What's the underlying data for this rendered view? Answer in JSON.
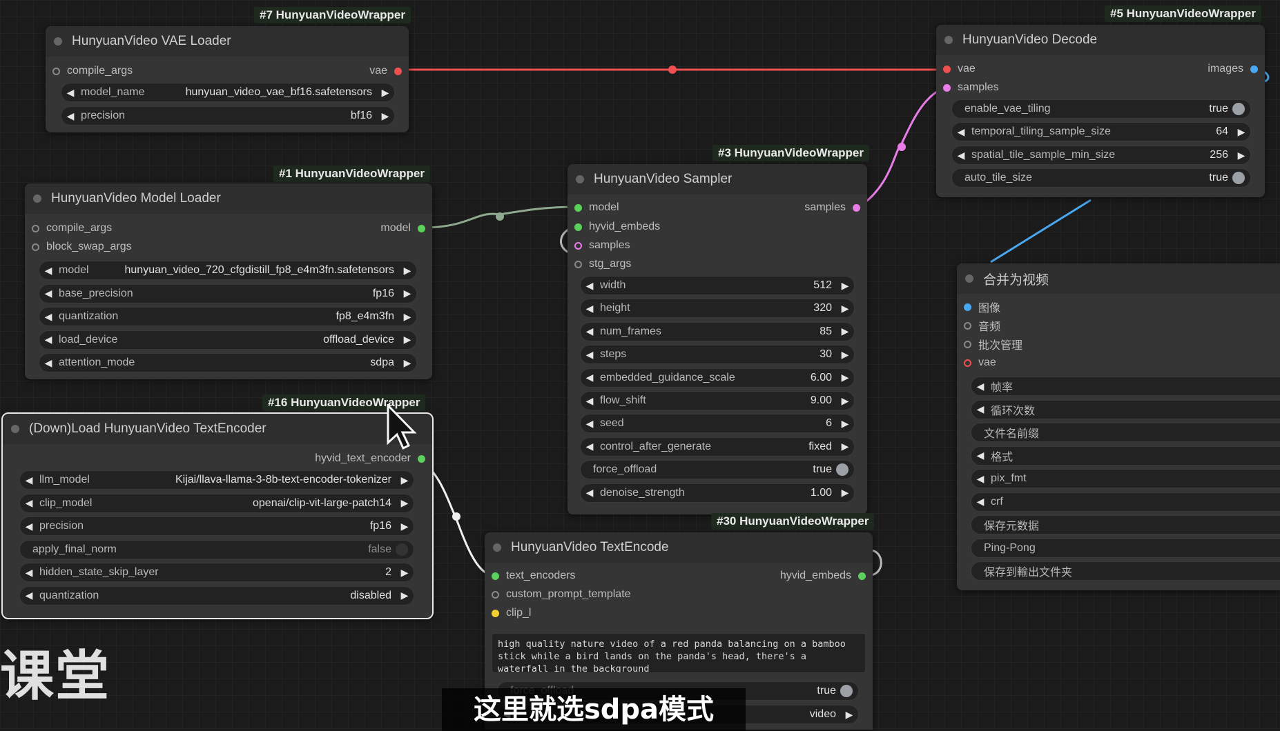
{
  "vae_loader": {
    "badge": "#7 HunyuanVideoWrapper",
    "title": "HunyuanVideo VAE Loader",
    "input_compile_args": "compile_args",
    "output_vae": "vae",
    "model_name_label": "model_name",
    "model_name_value": "hunyuan_video_vae_bf16.safetensors",
    "precision_label": "precision",
    "precision_value": "bf16"
  },
  "model_loader": {
    "badge": "#1 HunyuanVideoWrapper",
    "title": "HunyuanVideo Model Loader",
    "input_compile_args": "compile_args",
    "input_block_swap_args": "block_swap_args",
    "output_model": "model",
    "widgets": [
      {
        "label": "model",
        "value": "hunyuan_video_720_cfgdistill_fp8_e4m3fn.safetensors"
      },
      {
        "label": "base_precision",
        "value": "fp16"
      },
      {
        "label": "quantization",
        "value": "fp8_e4m3fn"
      },
      {
        "label": "load_device",
        "value": "offload_device"
      },
      {
        "label": "attention_mode",
        "value": "sdpa"
      }
    ]
  },
  "text_encoder_loader": {
    "badge": "#16 HunyuanVideoWrapper",
    "title": "(Down)Load HunyuanVideo TextEncoder",
    "output": "hyvid_text_encoder",
    "widgets": [
      {
        "label": "llm_model",
        "value": "Kijai/llava-llama-3-8b-text-encoder-tokenizer"
      },
      {
        "label": "clip_model",
        "value": "openai/clip-vit-large-patch14"
      },
      {
        "label": "precision",
        "value": "fp16"
      },
      {
        "label": "apply_final_norm",
        "value": "false"
      },
      {
        "label": "hidden_state_skip_layer",
        "value": "2"
      },
      {
        "label": "quantization",
        "value": "disabled"
      }
    ]
  },
  "sampler": {
    "badge": "#3 HunyuanVideoWrapper",
    "title": "HunyuanVideo Sampler",
    "inputs": [
      "model",
      "hyvid_embeds",
      "samples",
      "stg_args"
    ],
    "output": "samples",
    "widgets": [
      {
        "label": "width",
        "value": "512"
      },
      {
        "label": "height",
        "value": "320"
      },
      {
        "label": "num_frames",
        "value": "85"
      },
      {
        "label": "steps",
        "value": "30"
      },
      {
        "label": "embedded_guidance_scale",
        "value": "6.00"
      },
      {
        "label": "flow_shift",
        "value": "9.00"
      },
      {
        "label": "seed",
        "value": "6"
      },
      {
        "label": "control_after_generate",
        "value": "fixed"
      },
      {
        "label": "force_offload",
        "value": "true"
      },
      {
        "label": "denoise_strength",
        "value": "1.00"
      }
    ]
  },
  "decode": {
    "badge": "#5 HunyuanVideoWrapper",
    "title": "HunyuanVideo Decode",
    "inputs": [
      "vae",
      "samples"
    ],
    "output": "images",
    "widgets": [
      {
        "label": "enable_vae_tiling",
        "value": "true"
      },
      {
        "label": "temporal_tiling_sample_size",
        "value": "64"
      },
      {
        "label": "spatial_tile_sample_min_size",
        "value": "256"
      },
      {
        "label": "auto_tile_size",
        "value": "true"
      }
    ]
  },
  "text_encode": {
    "badge": "#30 HunyuanVideoWrapper",
    "title": "HunyuanVideo TextEncode",
    "inputs": [
      "text_encoders",
      "custom_prompt_template",
      "clip_l"
    ],
    "output": "hyvid_embeds",
    "prompt": "high quality nature video of a red panda balancing on a bamboo stick while a bird lands on the panda's head, there's a waterfall in the background",
    "force_offload_label": "force_offload",
    "force_offload_value": "true",
    "last_value": "video"
  },
  "video_combine": {
    "title": "合并为视频",
    "inputs": [
      "图像",
      "音频",
      "批次管理",
      "vae"
    ],
    "widgets": [
      "帧率",
      "循环次数",
      "文件名前缀",
      "格式",
      "pix_fmt",
      "crf",
      "保存元数据",
      "Ping-Pong",
      "保存到輸出文件夹"
    ]
  },
  "overlay": {
    "subtitle": "这里就选sdpa模式",
    "watermark": "课堂"
  },
  "colors": {
    "vae_link": "#f05050",
    "model_link": "#8fa98f",
    "samples_link": "#e97de8",
    "images_link": "#4aa8f0",
    "text_encoder_link": "#f0f0f0"
  }
}
